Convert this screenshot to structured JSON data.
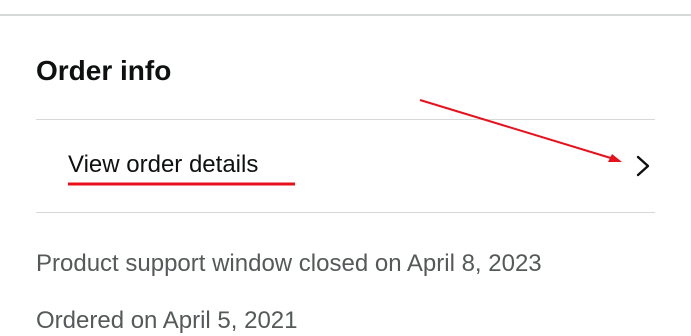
{
  "order_info": {
    "title": "Order info",
    "view_details_label": "View order details",
    "support_window_text": "Product support window closed on April 8, 2023",
    "ordered_text": "Ordered on April 5, 2021"
  },
  "icons": {
    "row_chevron": "chevron-right-icon"
  },
  "colors": {
    "annotation": "#e8111b",
    "divider": "#d5d9d9",
    "secondary_text": "#565959"
  }
}
